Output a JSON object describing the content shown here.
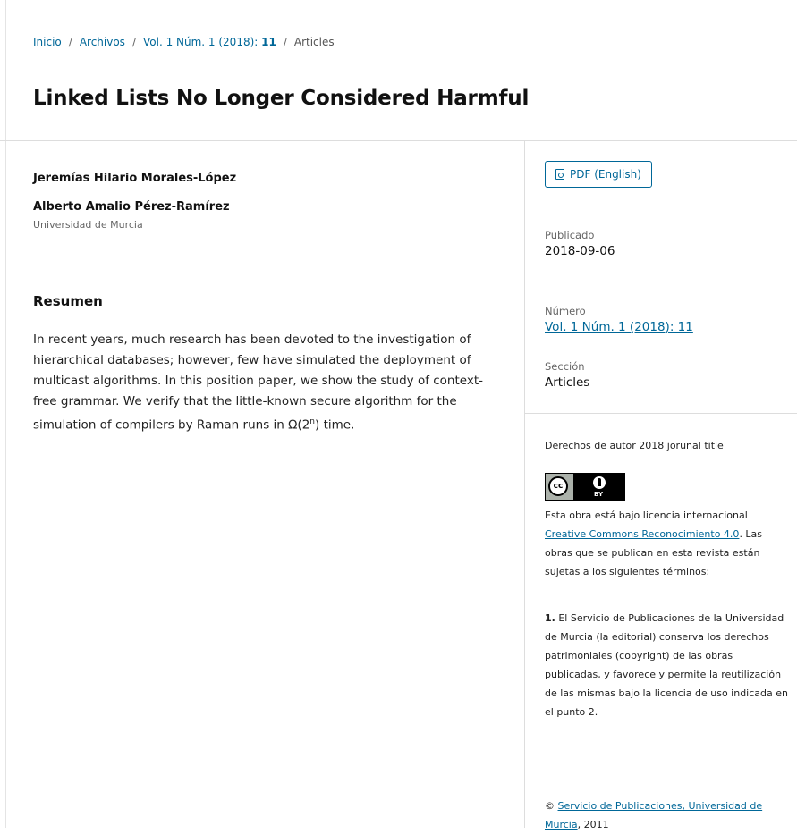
{
  "breadcrumb": {
    "home": "Inicio",
    "separator": "/",
    "archives": "Archivos",
    "issue_prefix": "Vol. 1 Núm. 1 (2018): ",
    "issue_bold": "11",
    "current": "Articles"
  },
  "article": {
    "title": "Linked Lists No Longer Considered Harmful",
    "authors": [
      {
        "name": "Jeremías Hilario Morales-López"
      },
      {
        "name": "Alberto Amalio Pérez-Ramírez",
        "affiliation": "Universidad de Murcia"
      }
    ],
    "abstract_heading": "Resumen",
    "abstract_before_sup": "In recent years, much research has been devoted to the investigation of hierarchical databases; however, few have simulated the deployment of multicast algorithms. In this position paper, we show the study of context-free grammar. We verify that the little-known secure algorithm for the simulation of compilers by Raman runs in Ω(2",
    "abstract_sup": "n",
    "abstract_after_sup": ") time."
  },
  "sidebar": {
    "pdf_label": "PDF (English)",
    "pdf_icon": "file-pdf-icon",
    "published_label": "Publicado",
    "published_value": "2018-09-06",
    "issue_label": "Número",
    "issue_value": "Vol. 1 Núm. 1 (2018): 11",
    "section_label": "Sección",
    "section_value": "Articles",
    "copyright": "Derechos de autor 2018 jorunal title",
    "license_icon": "cc-by-license-icon",
    "license_badge_cc": "cc",
    "license_badge_by": "BY",
    "license_prefix": "Esta obra está bajo licencia internacional",
    "license_link": "Creative Commons Reconocimiento 4.0",
    "license_suffix": ". Las obras que se publican en esta revista están sujetas a los siguientes términos:",
    "term1_number": "1.",
    "term1_text": " El Servicio de Publicaciones de la Universidad de Murcia (la editorial) conserva los derechos patrimoniales (copyright) de las obras publicadas, y favorece y permite la reutilización de las mismas bajo la licencia de uso indicada en el punto 2.",
    "footer_symbol": "©",
    "footer_link": "Servicio de Publicaciones, Universidad de Murcia",
    "footer_year": ", 2011"
  },
  "colors": {
    "link": "#006798",
    "border": "#dddddd",
    "text": "#222222"
  }
}
